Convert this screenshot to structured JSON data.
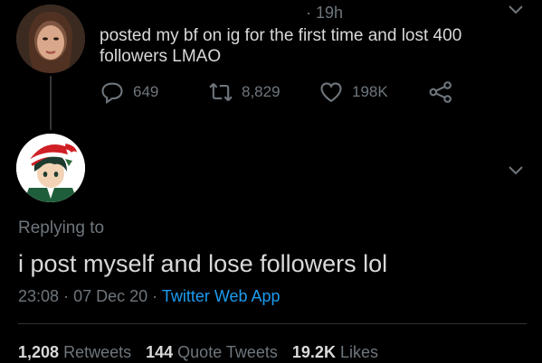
{
  "parent_tweet": {
    "timestamp": "· 19h",
    "text": "posted my bf on ig for the first time and lost 400 followers LMAO",
    "actions": {
      "reply_count": "649",
      "retweet_count": "8,829",
      "like_count": "198K"
    }
  },
  "main_tweet": {
    "replying_to": "Replying to",
    "text": "i post myself and lose followers lol",
    "time": "23:08",
    "date": "07 Dec 20",
    "separator": "·",
    "source": "Twitter Web App",
    "stats": {
      "retweets_count": "1,208",
      "retweets_label": "Retweets",
      "quote_count": "144",
      "quote_label": "Quote Tweets",
      "likes_count": "19.2K",
      "likes_label": "Likes"
    }
  },
  "colors": {
    "background": "#000000",
    "text": "#d9d9d9",
    "muted": "#6e767d",
    "link": "#1d9bf0"
  },
  "icons": [
    "reply-icon",
    "retweet-icon",
    "like-icon",
    "share-icon",
    "chevron-down-icon"
  ]
}
